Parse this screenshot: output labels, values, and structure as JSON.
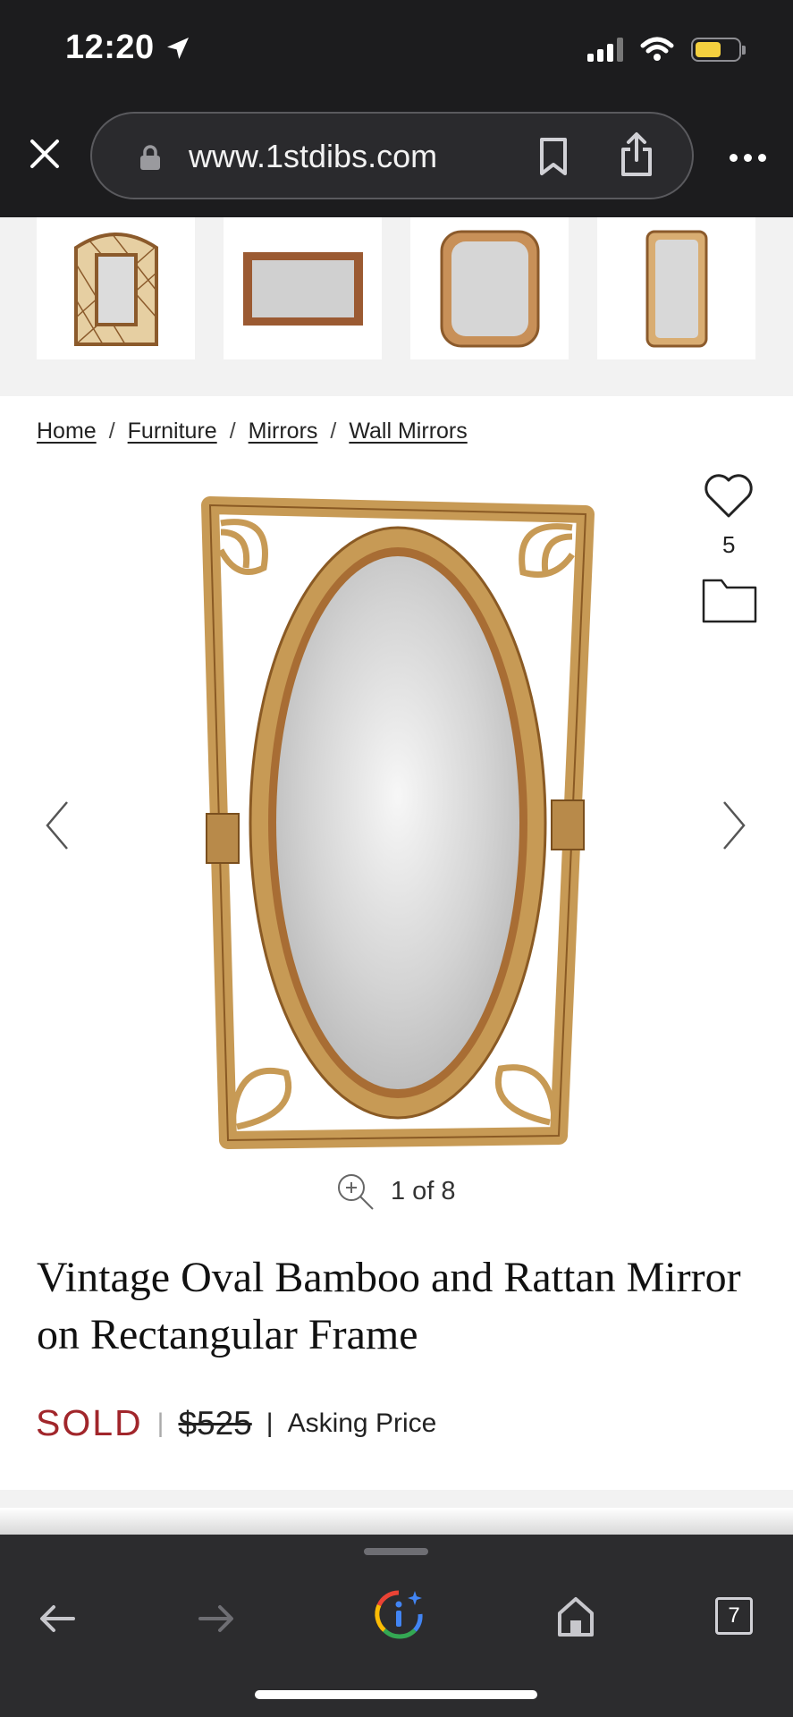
{
  "status": {
    "time": "12:20"
  },
  "browser": {
    "url": "www.1stdibs.com",
    "open_tabs": "7"
  },
  "breadcrumb": [
    {
      "label": "Home"
    },
    {
      "label": "Furniture"
    },
    {
      "label": "Mirrors"
    },
    {
      "label": "Wall Mirrors"
    }
  ],
  "gallery": {
    "counter": "1 of 8",
    "favorites_count": "5"
  },
  "product": {
    "title": "Vintage Oval Bamboo and Rattan Mirror on Rectangular Frame",
    "status": "SOLD",
    "price": "$525",
    "price_label": "Asking Price"
  },
  "colors": {
    "sold_red": "#a1262b",
    "browser_dark": "#1c1c1e",
    "toolbar_dark": "#2c2c2e",
    "battery_yellow": "#f4d03f"
  },
  "icons": [
    "location-arrow-icon",
    "signal-icon",
    "wifi-icon",
    "battery-icon",
    "close-icon",
    "lock-icon",
    "bookmark-icon",
    "share-icon",
    "more-icon",
    "heart-icon",
    "folder-icon",
    "chevron-left-icon",
    "chevron-right-icon",
    "zoom-icon",
    "back-arrow-icon",
    "forward-arrow-icon",
    "google-lens-icon",
    "home-icon",
    "tabs-icon"
  ]
}
